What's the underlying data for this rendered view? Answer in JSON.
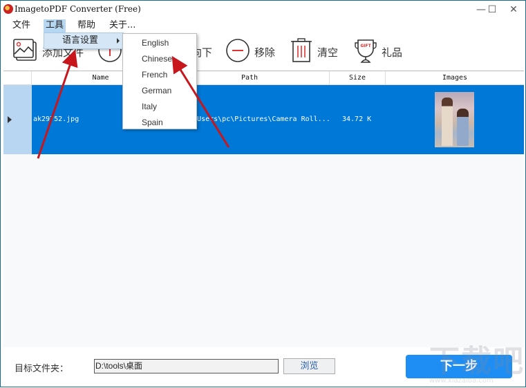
{
  "window": {
    "title": "ImagetoPDF Converter (Free)",
    "minimize": "—",
    "maximize": "☐",
    "close": "✕"
  },
  "menubar": {
    "items": [
      {
        "label": "文件"
      },
      {
        "label": "工具"
      },
      {
        "label": "帮助"
      },
      {
        "label": "关于..."
      }
    ]
  },
  "tools_menu": {
    "items": [
      {
        "label": "语言设置"
      }
    ]
  },
  "language_submenu": {
    "items": [
      {
        "label": "English"
      },
      {
        "label": "Chinese"
      },
      {
        "label": "French"
      },
      {
        "label": "German"
      },
      {
        "label": "Italy"
      },
      {
        "label": "Spain"
      }
    ]
  },
  "toolbar": {
    "add_file": "添加文件",
    "move_down": "向下",
    "remove": "移除",
    "clear": "清空",
    "gift": "礼品",
    "gift_badge": "GIFT"
  },
  "grid": {
    "columns": [
      "Name",
      "Path",
      "Size",
      "Images"
    ],
    "rows": [
      {
        "name": "ak29752.jpg",
        "path": "C:\\Users\\pc\\Pictures\\Camera Roll...",
        "size": "34.72 K"
      }
    ]
  },
  "bottom": {
    "target_label": "目标文件夹：",
    "target_path": "D:\\tools\\桌面",
    "browse": "浏览",
    "next": "下一步"
  },
  "watermark": {
    "text": "下载吧",
    "url": "www.xiazaiba.com"
  },
  "colors": {
    "selection": "#0078d7",
    "row_header": "#b8d6f2",
    "next_button": "#1e8ef4",
    "annotation_arrow": "#c8161d"
  }
}
